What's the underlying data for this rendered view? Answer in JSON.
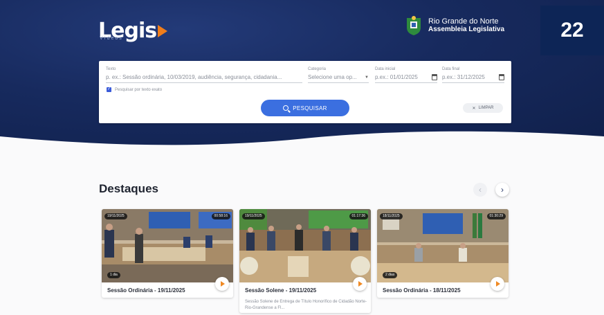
{
  "header": {
    "logo_text": "Legis",
    "logo_sub": "Vídeos",
    "assembly_line1": "Rio Grande do Norte",
    "assembly_line2": "Assembleia Legislativa",
    "badge": "22"
  },
  "search": {
    "text_label": "Texto",
    "text_placeholder": "p. ex.: Sessão ordinária, 10/03/2019, audiência, segurança, cidadania...",
    "category_label": "Categoria",
    "category_value": "Selecione uma op...",
    "start_label": "Data inicial",
    "start_placeholder": "p.ex.: 01/01/2025",
    "end_label": "Data final",
    "end_placeholder": "p.ex.: 31/12/2025",
    "exact_label": "Pesquisar por texto exato",
    "exact_checked": true,
    "search_button": "PESQUISAR",
    "clear_button": "LIMPAR"
  },
  "highlights": {
    "title": "Destaques",
    "cards": [
      {
        "date": "19/11/2025",
        "duration": "00:58:16",
        "age": "1 dia",
        "title": "Sessão Ordinária - 19/11/2025",
        "description": ""
      },
      {
        "date": "19/11/2025",
        "duration": "01:17:36",
        "age": "",
        "title": "Sessão Solene - 19/11/2025",
        "description": "Sessão Solene de Entrega de Título Honorífico de Cidadão Norte-Rio-Grandense a Fl..."
      },
      {
        "date": "18/11/2025",
        "duration": "01:30:29",
        "age": "2 dias",
        "title": "Sessão Ordinária - 18/11/2025",
        "description": ""
      }
    ]
  },
  "colors": {
    "hero": "#172a5e",
    "accent": "#3b6fe0",
    "play": "#f08a24",
    "badge_bg": "#0d2556"
  }
}
